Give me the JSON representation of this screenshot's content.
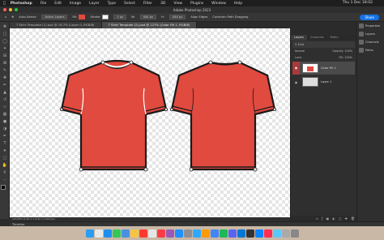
{
  "menubar": {
    "app": "Photoshop",
    "items": [
      "File",
      "Edit",
      "Image",
      "Layer",
      "Type",
      "Select",
      "Filter",
      "3D",
      "View",
      "Plugins",
      "Window",
      "Help"
    ],
    "clock": "Thu 1 Dec 18:02"
  },
  "window": {
    "title": "Adobe Photoshop 2023"
  },
  "options": {
    "auto_select": "Auto-Select:",
    "target": "Active Layers",
    "fill": "Fill:",
    "stroke": "Stroke:",
    "stroke_size": "1 px",
    "w_label": "W:",
    "w_value": "444 px",
    "h_label": "H:",
    "h_value": "444 px",
    "align_edges": "Align Edges",
    "constrain": "Constrain Path Dragging",
    "share": "Share"
  },
  "tabs": [
    {
      "label": "T Shirt Template (1).psd @ 16.7% (Layer 0, RGB/8)"
    },
    {
      "label": "T Shirt Template (2).psd @ 127% (Color Fill 1, RGB/8)"
    }
  ],
  "status": {
    "text": "126.85%   6.48 in x 8.92 in (300 ppi)"
  },
  "timeline": {
    "label": "Timeline"
  },
  "layers_panel": {
    "tabs": [
      "Layers",
      "Channels",
      "Paths"
    ],
    "filter": "Kind",
    "blend": "Normal",
    "opacity": "Opacity: 100%",
    "lock": "Lock:",
    "fill": "Fill: 100%",
    "layers": [
      {
        "name": "Color Fill 1",
        "selected": true
      },
      {
        "name": "Layer 1",
        "selected": false
      }
    ]
  },
  "right_dock": {
    "items": [
      "Properties",
      "Layers",
      "Channels",
      "Paths"
    ]
  },
  "colors": {
    "shirt": "#e04a3f",
    "outline": "#1a1a1a",
    "accent": "#1473e6"
  }
}
